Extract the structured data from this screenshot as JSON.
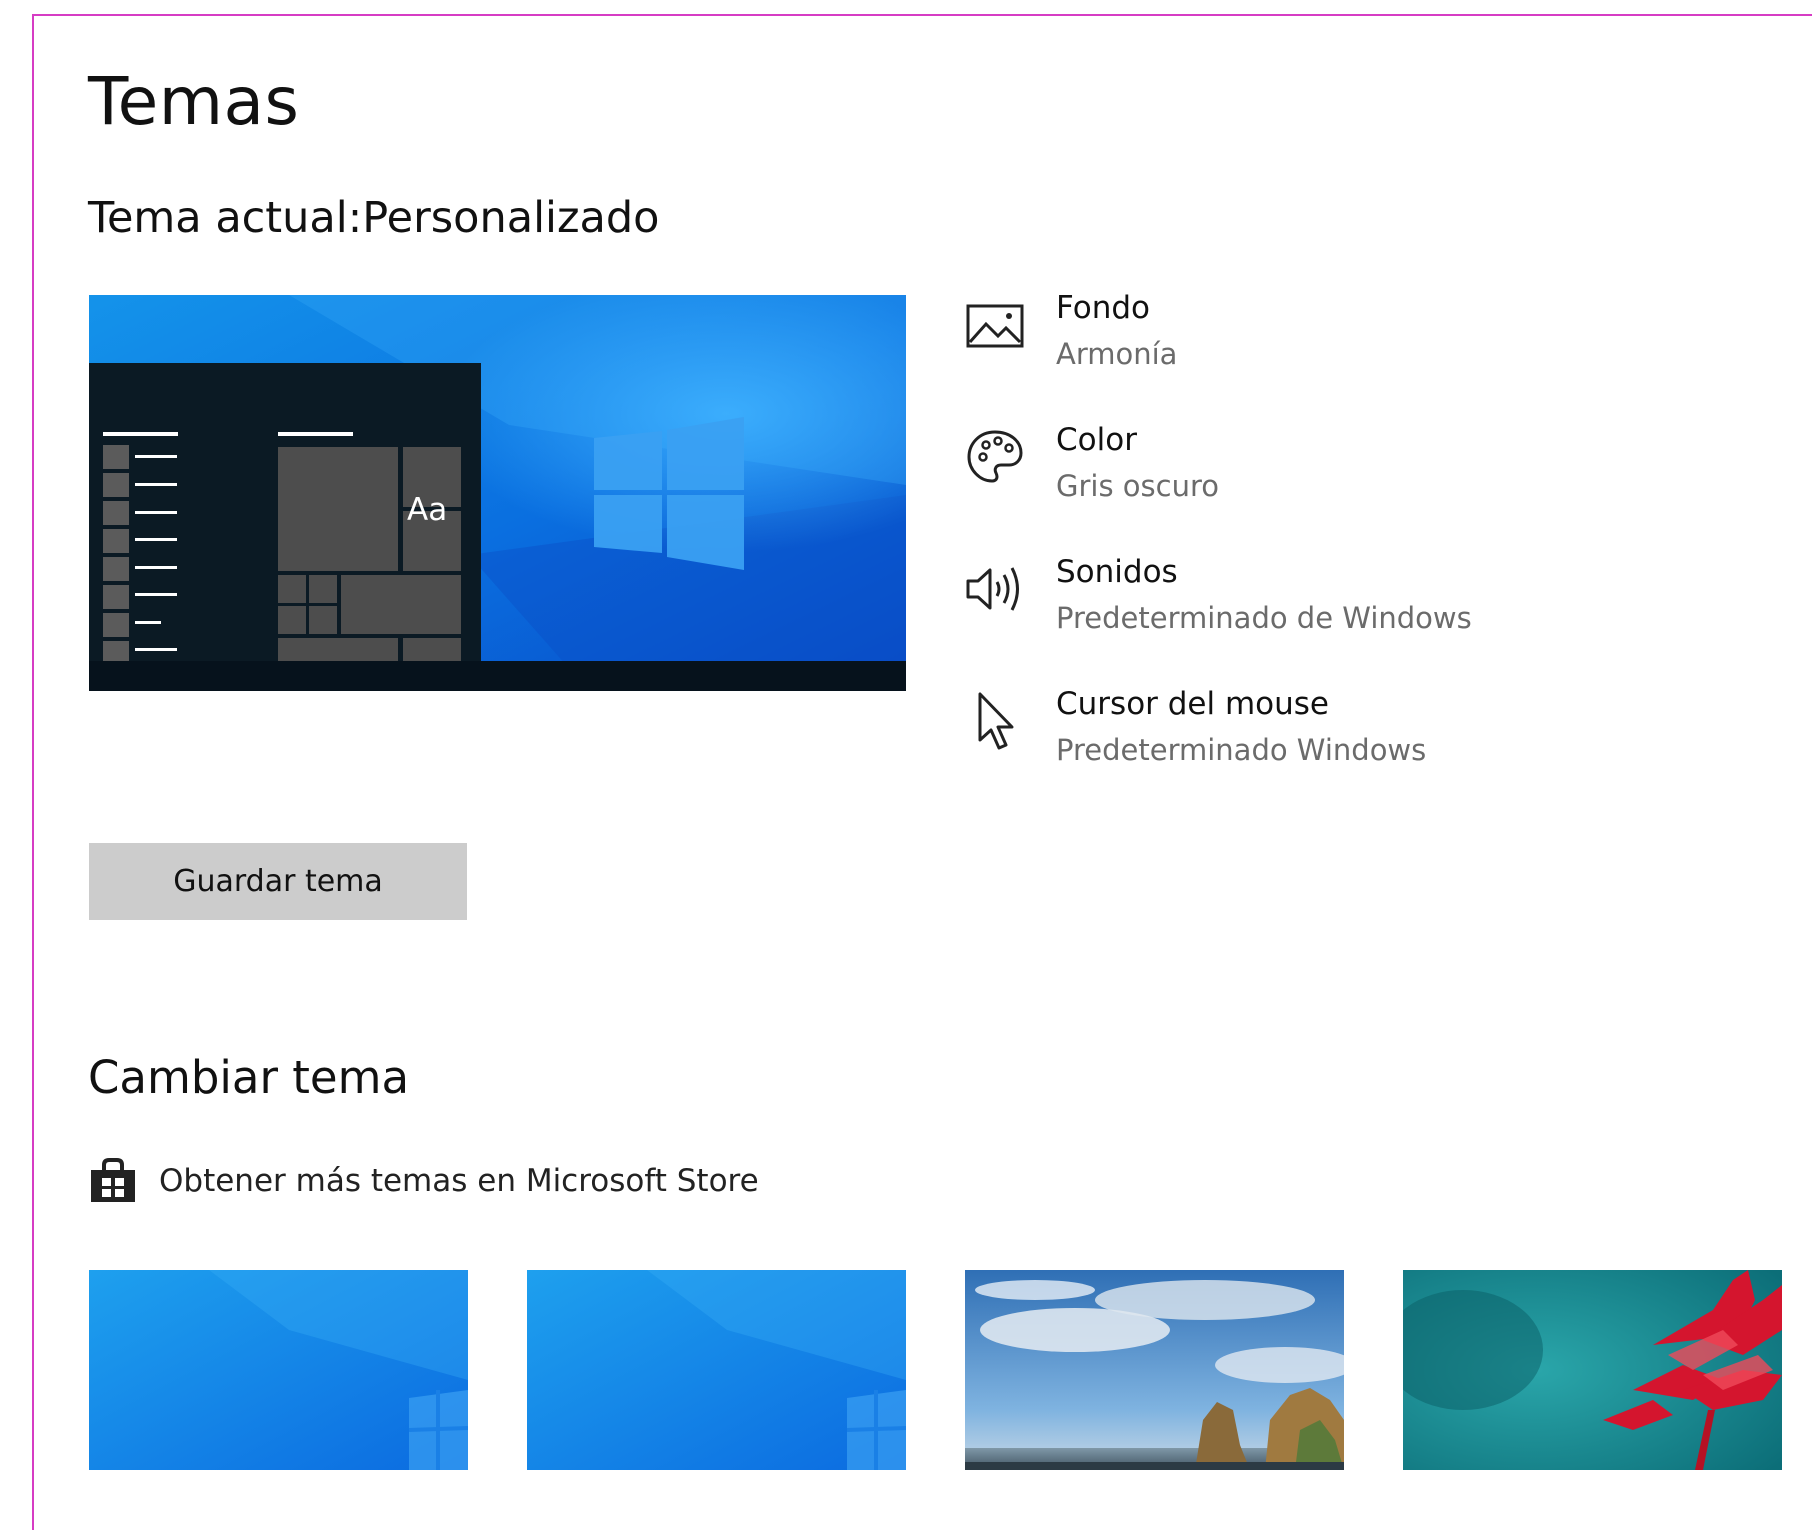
{
  "page": {
    "title": "Temas",
    "current_theme_label": "Tema actual:",
    "current_theme_value": "Personalizado"
  },
  "preview": {
    "sample_text": "Aa"
  },
  "properties": [
    {
      "title": "Fondo",
      "value": "Armonía",
      "icon": "picture-icon"
    },
    {
      "title": "Color",
      "value": "Gris oscuro",
      "icon": "palette-icon"
    },
    {
      "title": "Sonidos",
      "value": "Predeterminado de Windows",
      "icon": "speaker-icon"
    },
    {
      "title": "Cursor del mouse",
      "value": "Predeterminado Windows",
      "icon": "cursor-icon"
    }
  ],
  "actions": {
    "save_label": "Guardar tema"
  },
  "change_theme": {
    "title": "Cambiar tema",
    "store_link": "Obtener más temas en Microsoft Store",
    "store_icon": "shopping-bag-icon",
    "themes": [
      {
        "name": "windows-blue-1"
      },
      {
        "name": "windows-blue-2"
      },
      {
        "name": "beach-rocks"
      },
      {
        "name": "red-flower"
      }
    ]
  },
  "colors": {
    "accent_blue": "#0a6fe0",
    "button_gray": "#cccccc",
    "frame_border": "#d63cc4",
    "secondary_text": "#6b6b6b"
  }
}
